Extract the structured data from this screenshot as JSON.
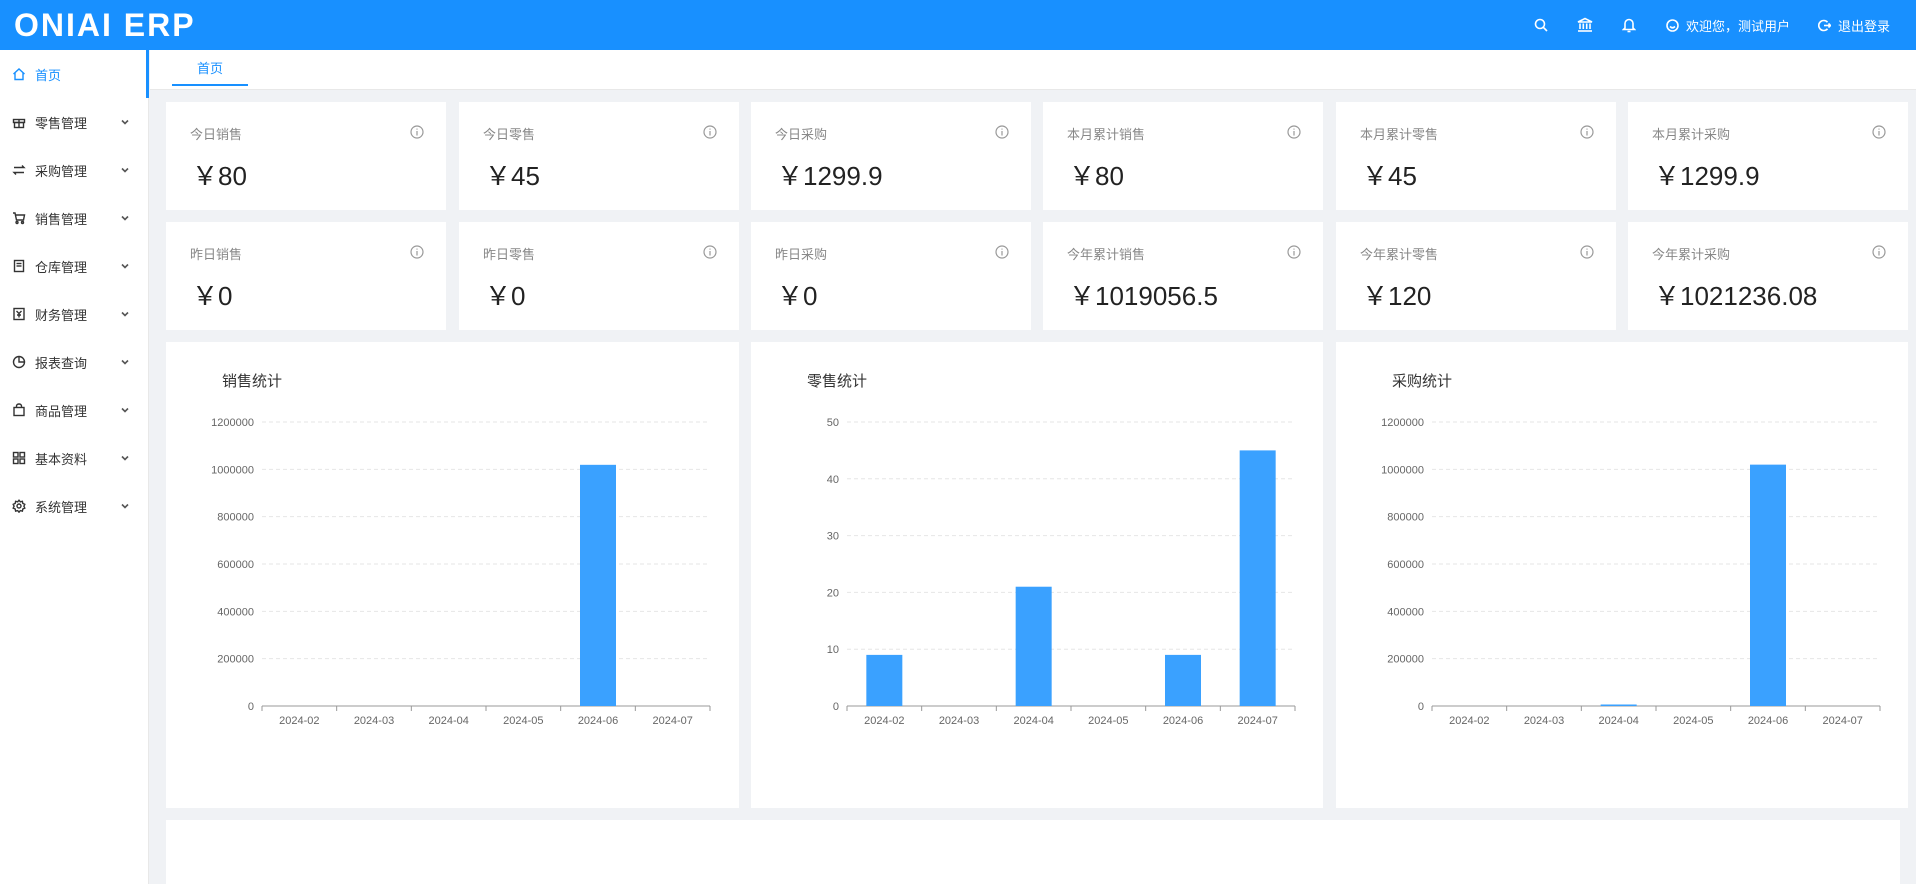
{
  "app": {
    "logo": "ONIAI ERP"
  },
  "header": {
    "welcome": "欢迎您，测试用户",
    "logout": "退出登录"
  },
  "sidebar": {
    "items": [
      {
        "label": "首页",
        "icon": "home-icon",
        "active": true
      },
      {
        "label": "零售管理",
        "icon": "gift-icon"
      },
      {
        "label": "采购管理",
        "icon": "swap-icon"
      },
      {
        "label": "销售管理",
        "icon": "cart-icon"
      },
      {
        "label": "仓库管理",
        "icon": "book-icon"
      },
      {
        "label": "财务管理",
        "icon": "finance-icon"
      },
      {
        "label": "报表查询",
        "icon": "pie-icon"
      },
      {
        "label": "商品管理",
        "icon": "bag-icon"
      },
      {
        "label": "基本资料",
        "icon": "grid-icon"
      },
      {
        "label": "系统管理",
        "icon": "gear-icon"
      }
    ]
  },
  "tabs": [
    {
      "label": "首页"
    }
  ],
  "stats": [
    {
      "label": "今日销售",
      "value": "￥80"
    },
    {
      "label": "今日零售",
      "value": "￥45"
    },
    {
      "label": "今日采购",
      "value": "￥1299.9"
    },
    {
      "label": "本月累计销售",
      "value": "￥80"
    },
    {
      "label": "本月累计零售",
      "value": "￥45"
    },
    {
      "label": "本月累计采购",
      "value": "￥1299.9"
    },
    {
      "label": "昨日销售",
      "value": "￥0"
    },
    {
      "label": "昨日零售",
      "value": "￥0"
    },
    {
      "label": "昨日采购",
      "value": "￥0"
    },
    {
      "label": "今年累计销售",
      "value": "￥1019056.5"
    },
    {
      "label": "今年累计零售",
      "value": "￥120"
    },
    {
      "label": "今年累计采购",
      "value": "￥1021236.08"
    }
  ],
  "colors": {
    "primary": "#1890ff",
    "bar": "#3aa1ff"
  },
  "chart_data": [
    {
      "type": "bar",
      "title": "销售统计",
      "categories": [
        "2024-02",
        "2024-03",
        "2024-04",
        "2024-05",
        "2024-06",
        "2024-07"
      ],
      "values": [
        0,
        0,
        0,
        0,
        1019056.5,
        0
      ],
      "ylim": [
        0,
        1200000
      ],
      "yticks": [
        "0",
        "200000",
        "400000",
        "600000",
        "800000",
        "1000000",
        "1200000"
      ],
      "grid": true
    },
    {
      "type": "bar",
      "title": "零售统计",
      "categories": [
        "2024-02",
        "2024-03",
        "2024-04",
        "2024-05",
        "2024-06",
        "2024-07"
      ],
      "values": [
        9,
        0,
        21,
        0,
        9,
        45
      ],
      "ylim": [
        0,
        50
      ],
      "yticks": [
        "0",
        "10",
        "20",
        "30",
        "40",
        "50"
      ],
      "grid": true
    },
    {
      "type": "bar",
      "title": "采购统计",
      "categories": [
        "2024-02",
        "2024-03",
        "2024-04",
        "2024-05",
        "2024-06",
        "2024-07"
      ],
      "values": [
        0,
        0,
        1100,
        0,
        1019836.18,
        0
      ],
      "ylim": [
        0,
        1200000
      ],
      "yticks": [
        "0",
        "200000",
        "400000",
        "600000",
        "800000",
        "1000000",
        "1200000"
      ],
      "grid": true
    }
  ]
}
